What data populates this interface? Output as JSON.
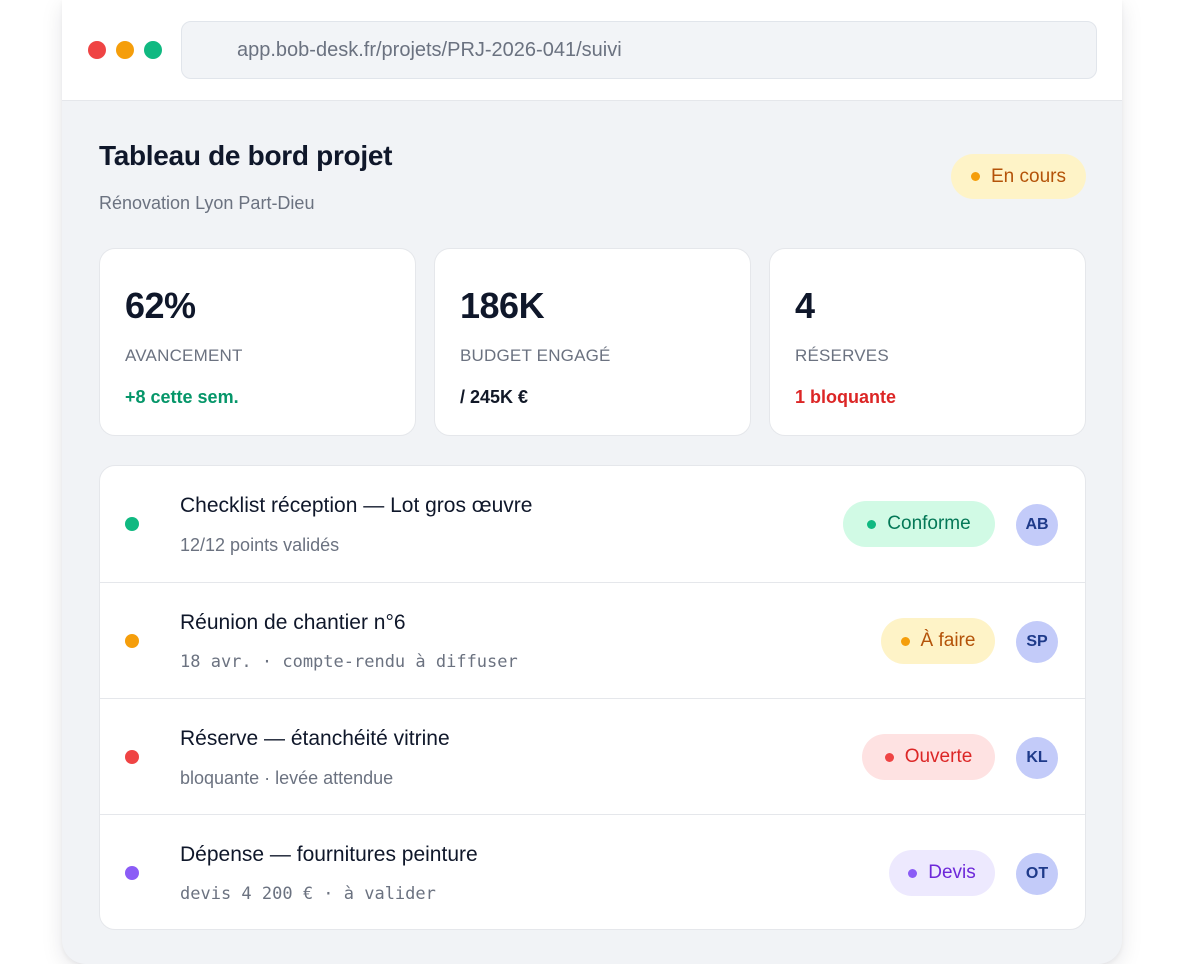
{
  "colors": {
    "window_bg": "#f1f3f6",
    "success": "#10b981",
    "warning": "#f59e0b",
    "danger": "#ef4444",
    "info": "#8b5cf6"
  },
  "browser": {
    "url": "app.bob-desk.fr/projets/PRJ-2026-041/suivi"
  },
  "header": {
    "title": "Tableau de bord projet",
    "subtitle": "Rénovation Lyon Part-Dieu",
    "status": "En cours"
  },
  "stats": [
    {
      "value": "62%",
      "label": "AVANCEMENT",
      "sub": "+8 cette sem."
    },
    {
      "value": "186K",
      "label": "BUDGET ENGAGÉ",
      "sub": "/ 245K €"
    },
    {
      "value": "4",
      "label": "RÉSERVES",
      "sub": "1 bloquante"
    }
  ],
  "tasks": [
    {
      "title": "Checklist réception — Lot gros œuvre",
      "meta": "12/12 points validés",
      "status": "Conforme",
      "assignee": "AB",
      "dot_color": "#10b981"
    },
    {
      "title": "Réunion de chantier n°6",
      "meta": "18 avr. · compte-rendu à diffuser",
      "status": "À faire",
      "assignee": "SP",
      "dot_color": "#f59e0b"
    },
    {
      "title": "Réserve — étanchéité vitrine",
      "meta": "bloquante · levée attendue",
      "status": "Ouverte",
      "assignee": "KL",
      "dot_color": "#ef4444"
    },
    {
      "title": "Dépense — fournitures peinture",
      "meta": "devis 4 200 € · à valider",
      "status": "Devis",
      "assignee": "OT",
      "dot_color": "#8b5cf6"
    }
  ]
}
